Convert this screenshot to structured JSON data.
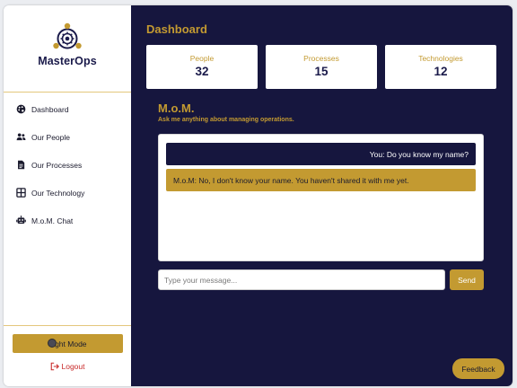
{
  "brand": {
    "name": "MasterOps"
  },
  "sidebar": {
    "items": [
      {
        "label": "Dashboard",
        "icon": "palette-icon"
      },
      {
        "label": "Our People",
        "icon": "users-icon"
      },
      {
        "label": "Our Processes",
        "icon": "document-icon"
      },
      {
        "label": "Our Technology",
        "icon": "grid-icon"
      },
      {
        "label": "M.o.M. Chat",
        "icon": "robot-icon"
      }
    ],
    "light_mode_label": "Light Mode",
    "logout_label": "Logout"
  },
  "dashboard": {
    "title": "Dashboard",
    "stats": [
      {
        "label": "People",
        "value": "32"
      },
      {
        "label": "Processes",
        "value": "15"
      },
      {
        "label": "Technologies",
        "value": "12"
      }
    ]
  },
  "chat": {
    "title": "M.o.M.",
    "subtitle": "Ask me anything about managing operations.",
    "messages": [
      {
        "role": "user",
        "text": "You: Do you know my name?"
      },
      {
        "role": "bot",
        "text": "M.o.M: No, I don't know your name. You haven't shared it with me yet."
      }
    ],
    "input_placeholder": "Type your message...",
    "input_value": "",
    "send_label": "Send"
  },
  "feedback_label": "Feedback",
  "colors": {
    "gold": "#c39a31",
    "navy": "#16163e",
    "logout_red": "#c82828"
  }
}
